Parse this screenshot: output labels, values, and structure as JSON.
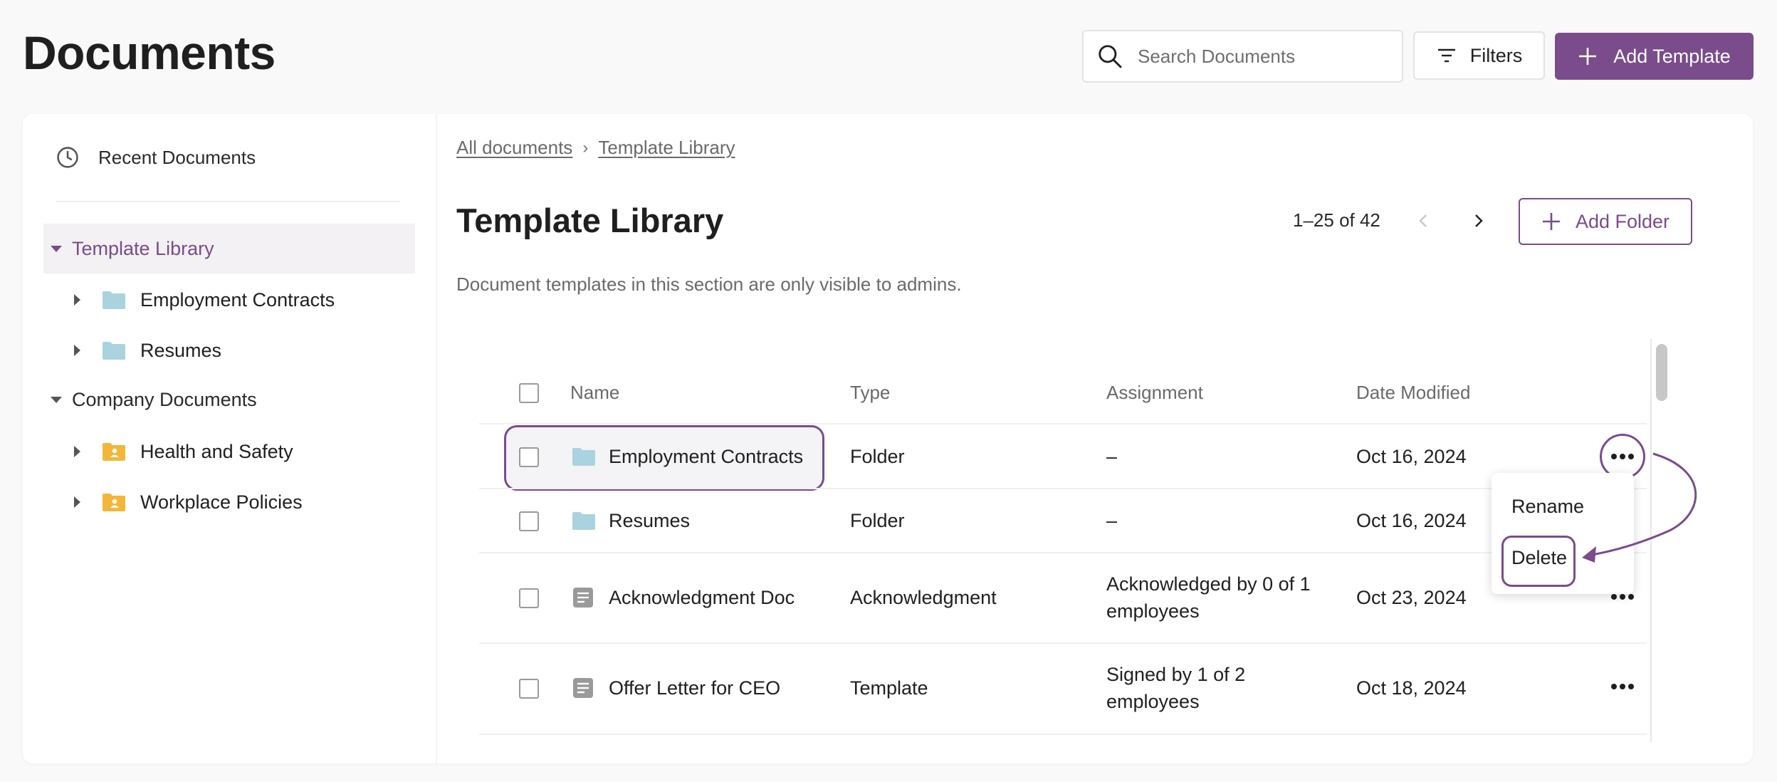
{
  "page": {
    "title": "Documents"
  },
  "header": {
    "search_placeholder": "Search Documents",
    "filters_label": "Filters",
    "add_template_label": "Add Template"
  },
  "sidebar": {
    "recent_label": "Recent Documents",
    "template_library": {
      "label": "Template Library",
      "children": [
        {
          "label": "Employment Contracts",
          "icon": "folder-icon"
        },
        {
          "label": "Resumes",
          "icon": "folder-icon"
        }
      ]
    },
    "company_documents": {
      "label": "Company Documents",
      "children": [
        {
          "label": "Health and Safety",
          "icon": "shared-folder-icon"
        },
        {
          "label": "Workplace Policies",
          "icon": "shared-folder-icon"
        }
      ]
    }
  },
  "breadcrumb": {
    "items": [
      "All documents",
      "Template Library"
    ],
    "separator": "›"
  },
  "main": {
    "title": "Template Library",
    "description": "Document templates in this section are only visible to admins.",
    "pagination": "1–25 of 42",
    "add_folder_label": "Add Folder"
  },
  "table": {
    "columns": [
      "Name",
      "Type",
      "Assignment",
      "Date Modified"
    ],
    "rows": [
      {
        "name": "Employment Contracts",
        "type": "Folder",
        "assignment_line1": "–",
        "assignment_line2": "",
        "date": "Oct 16, 2024",
        "icon": "folder-icon"
      },
      {
        "name": "Resumes",
        "type": "Folder",
        "assignment_line1": "–",
        "assignment_line2": "",
        "date": "Oct 16, 2024",
        "icon": "folder-icon"
      },
      {
        "name": "Acknowledgment Doc",
        "type": "Acknowledgment",
        "assignment_line1": "Acknowledged by 0 of 1",
        "assignment_line2": "employees",
        "date": "Oct 23, 2024",
        "icon": "document-icon"
      },
      {
        "name": "Offer Letter for CEO",
        "type": "Template",
        "assignment_line1": "Signed by 1 of 2",
        "assignment_line2": "employees",
        "date": "Oct 18, 2024",
        "icon": "document-icon"
      }
    ]
  },
  "context_menu": {
    "items": [
      "Rename",
      "Delete"
    ]
  },
  "colors": {
    "accent": "#7a4c8b",
    "folder_blue": "#a9d3df",
    "folder_yellow": "#f2b73a",
    "doc_gray": "#9a9a9a"
  }
}
